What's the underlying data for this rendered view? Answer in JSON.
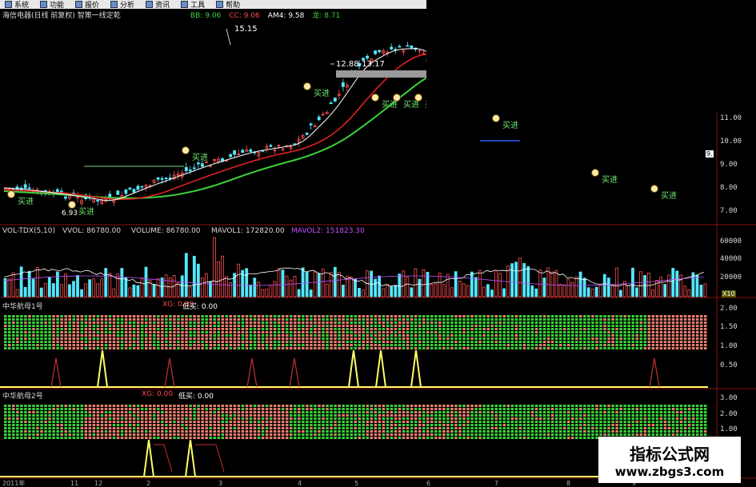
{
  "menu": [
    "系统",
    "功能",
    "报价",
    "分析",
    "资讯",
    "工具",
    "帮助"
  ],
  "price_panel": {
    "title": "海信电器(日线 前复权) 智策一线定乾",
    "ind": [
      {
        "label": "BB: 9.06",
        "color": "#3ad23a"
      },
      {
        "label": "CC: 9.06",
        "color": "#ff4a4a"
      },
      {
        "label": "AM4: 9.58",
        "color": "#ffffff"
      },
      {
        "label": "龙: 8.71",
        "color": "#3ad23a"
      }
    ],
    "high_label": "15.15",
    "range_label": "12.88-13.17",
    "low_label": "6.93",
    "right_tag": "9.",
    "buy_label": "买进",
    "y_ticks": [
      "11.00",
      "10.00",
      "9.00",
      "8.00",
      "7.00"
    ]
  },
  "volume_panel": {
    "title": "VOL-TDX(5,10)",
    "vvol": "VVOL: 86780.00",
    "volume": "VOLUME: 86780.00",
    "mavol1": "MAVOL1: 172820.00",
    "mavol2": "MAVOL2: 151823.30",
    "y_ticks": [
      "60000",
      "40000",
      "20000"
    ],
    "unit": "X10"
  },
  "indicator1": {
    "title": "中华航母1号",
    "xg": "XG: 0.00",
    "dimai": "低买: 0.00",
    "y_ticks": [
      "2.00",
      "1.50",
      "1.00",
      "0.50"
    ]
  },
  "indicator2": {
    "title": "中华航母2号",
    "xg": "XG: 0.00",
    "dimai": "低买: 0.00",
    "y_ticks": [
      "3.00",
      "2.00",
      "1.00"
    ]
  },
  "x_axis": {
    "first": "2011年",
    "ticks": [
      "11",
      "12",
      "2",
      "3",
      "4",
      "5",
      "6",
      "7",
      "8",
      "9"
    ]
  },
  "watermark": {
    "line1": "指标公式网",
    "line2": "www.zbgs3.com"
  },
  "colors": {
    "up": "#ff4f4f",
    "down": "#54e8ff",
    "ma_green": "#3ad23a",
    "ma_red": "#e02020",
    "ma_white": "#ffffff",
    "signal": "#ffff66",
    "grid": "#7a1010"
  }
}
